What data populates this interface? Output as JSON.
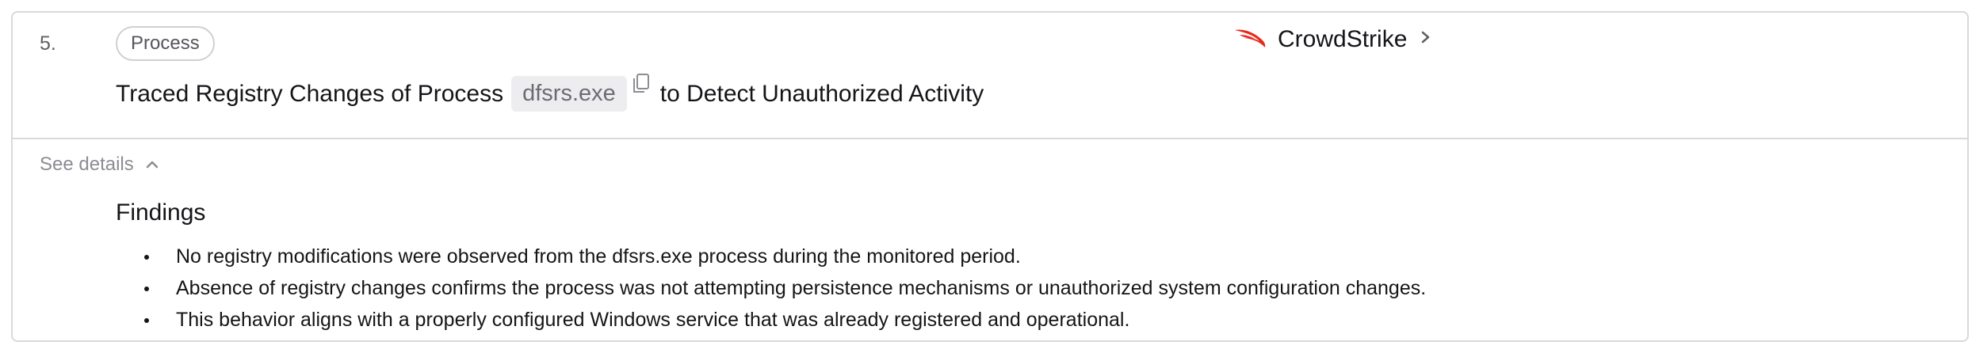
{
  "step": {
    "number": "5.",
    "tag": "Process"
  },
  "title": {
    "before": "Traced Registry Changes of Process",
    "code": "dfsrs.exe",
    "after": "to Detect Unauthorized Activity"
  },
  "vendor": {
    "name": "CrowdStrike",
    "logo": "crowdstrike-falcon-icon",
    "color": "#e8291c"
  },
  "details_toggle": {
    "label": "See details",
    "state": "expanded"
  },
  "findings": {
    "heading": "Findings",
    "items": [
      "No registry modifications were observed from the dfsrs.exe process during the monitored period.",
      "Absence of registry changes confirms the process was not attempting persistence mechanisms or unauthorized system configuration changes.",
      "This behavior aligns with a properly configured Windows service that was already registered and operational."
    ]
  }
}
